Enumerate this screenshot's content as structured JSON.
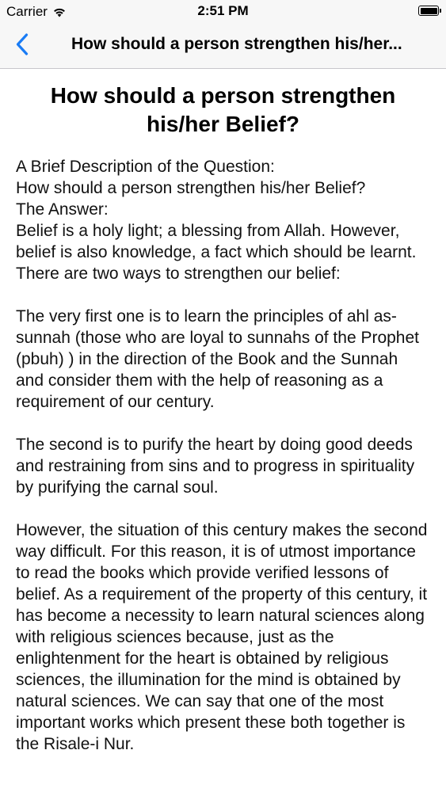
{
  "status_bar": {
    "carrier": "Carrier",
    "time": "2:51 PM"
  },
  "nav": {
    "title": "How should a person strengthen his/her..."
  },
  "article": {
    "title": "How should a person strengthen his/her Belief?",
    "intro": [
      "A Brief Description of the Question:",
      "How should a person strengthen his/her Belief?",
      "The Answer:",
      "Belief is a holy  light; a blessing from Allah. However, belief is also knowledge, a fact which should be learnt. There are two ways to strengthen our belief:"
    ],
    "paragraphs": [
      "The very first one is to learn the principles of ahl as-sunnah (those who are loyal to sunnahs of the Prophet (pbuh) ) in the direction of the Book and the Sunnah and consider them with the help of reasoning as a requirement of our century.",
      "The second is to purify the heart by doing good deeds and restraining from sins and to progress in spirituality by purifying the carnal soul.",
      "However, the situation of this century makes the second way difficult. For this reason, it is of utmost importance to read the books which provide verified lessons of belief. As a requirement of the property of this century, it has become a necessity to learn natural sciences along with religious sciences because, just as the enlightenment for the heart is obtained by religious sciences, the illumination for the mind is obtained by natural sciences. We can say that one of the most important works which present these both together is the Risale-i Nur."
    ]
  }
}
